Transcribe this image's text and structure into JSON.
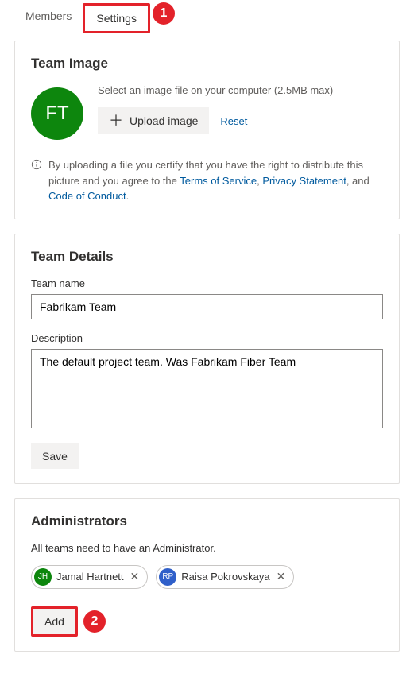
{
  "tabs": {
    "members": "Members",
    "settings": "Settings"
  },
  "teamImage": {
    "heading": "Team Image",
    "initials": "FT",
    "hint": "Select an image file on your computer (2.5MB max)",
    "uploadLabel": "Upload image",
    "resetLabel": "Reset",
    "certifyPrefix": "By uploading a file you certify that you have the right to distribute this picture and you agree to the ",
    "tosLabel": "Terms of Service",
    "comma": ", ",
    "privacyLabel": "Privacy Statement",
    "and": ", and ",
    "cocLabel": "Code of Conduct",
    "period": "."
  },
  "teamDetails": {
    "heading": "Team Details",
    "nameLabel": "Team name",
    "nameValue": "Fabrikam Team",
    "descLabel": "Description",
    "descValue": "The default project team. Was Fabrikam Fiber Team",
    "saveLabel": "Save"
  },
  "admins": {
    "heading": "Administrators",
    "subtext": "All teams need to have an Administrator.",
    "people": [
      {
        "initials": "JH",
        "name": "Jamal Hartnett",
        "color": "#0d860d"
      },
      {
        "initials": "RP",
        "name": "Raisa Pokrovskaya",
        "color": "#2f5fc9"
      }
    ],
    "addLabel": "Add"
  },
  "callouts": {
    "one": "1",
    "two": "2"
  }
}
